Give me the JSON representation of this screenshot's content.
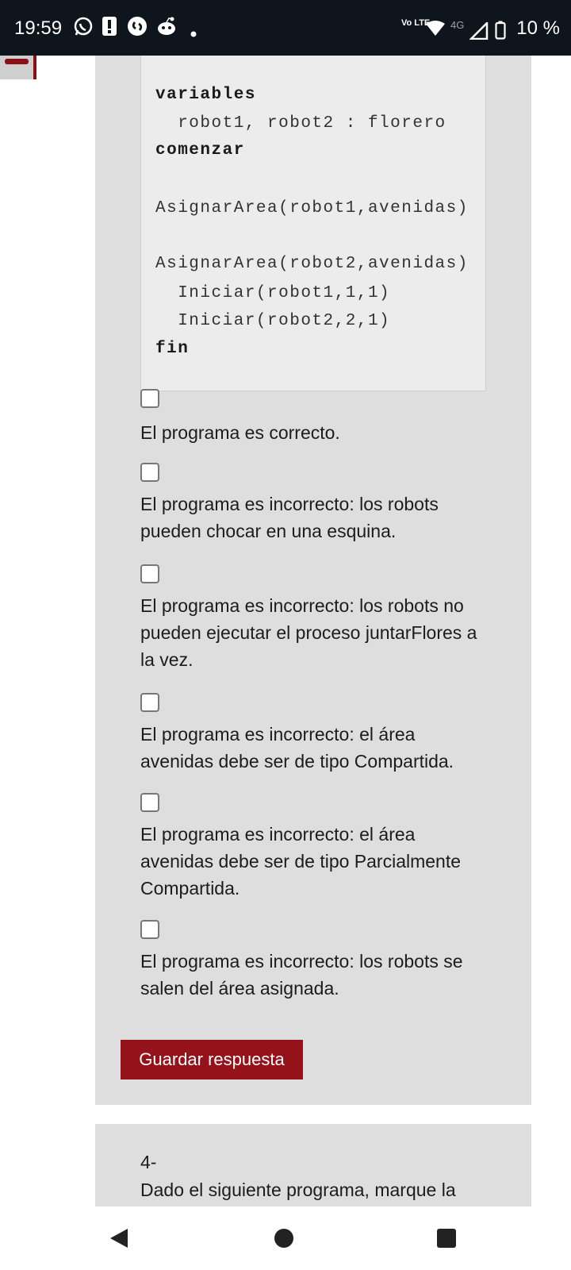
{
  "status_bar": {
    "time": "19:59",
    "network": "4G",
    "volte": "Vo LTE",
    "battery": "10 %"
  },
  "code_block": {
    "lines": [
      "variables",
      "  robot1, robot2 : florero",
      "comenzar",
      "AsignarArea(robot1,avenidas)",
      "AsignarArea(robot2,avenidas)",
      "  Iniciar(robot1,1,1)",
      "  Iniciar(robot2,2,1)",
      "fin"
    ]
  },
  "options": [
    {
      "label": "El programa es correcto.",
      "checked": false
    },
    {
      "label": "El programa es incorrecto: los robots pueden chocar en una esquina.",
      "checked": false
    },
    {
      "label": "El programa es incorrecto: los robots no pueden ejecutar el proceso juntarFlores a la vez.",
      "checked": false
    },
    {
      "label": "El programa es incorrecto: el área avenidas debe ser de tipo Compartida.",
      "checked": false
    },
    {
      "label": "El programa es incorrecto: el área avenidas debe ser de tipo Parcialmente Compartida.",
      "checked": false
    },
    {
      "label": "El programa es incorrecto: los robots se salen del área asignada.",
      "checked": false
    }
  ],
  "save_button": "Guardar respuesta",
  "next_question": {
    "number": "4-",
    "text": "Dado el siguiente programa, marque la"
  },
  "colors": {
    "accent": "#96121b",
    "card_bg": "#dedede",
    "code_bg": "#ececec",
    "status_bg": "#0e151c"
  }
}
